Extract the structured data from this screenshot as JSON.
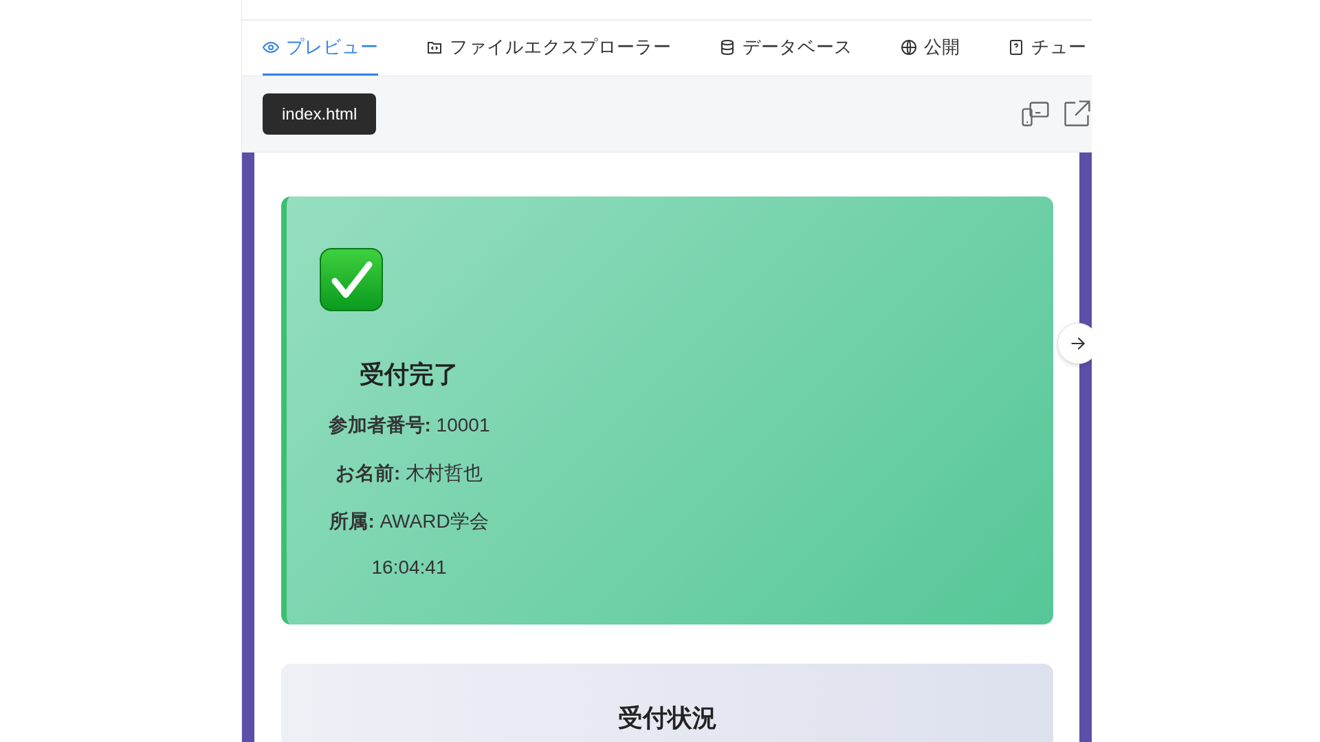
{
  "tabs": [
    {
      "label": "プレビュー",
      "kind": "preview",
      "selected": true
    },
    {
      "label": "ファイルエクスプローラー",
      "kind": "files",
      "selected": false
    },
    {
      "label": "データベース",
      "kind": "database",
      "selected": false
    },
    {
      "label": "公開",
      "kind": "publish",
      "selected": false
    },
    {
      "label": "チュー",
      "kind": "help",
      "selected": false
    }
  ],
  "file_tab": {
    "label": "index.html"
  },
  "status_card": {
    "title": "受付完了",
    "lines": [
      "**参加者番号:** 10001",
      "**お名前:** 木村哲也",
      "**所属:** AWARD学会",
      "16:04:41"
    ]
  },
  "summary_card": {
    "title": "受付状況"
  }
}
